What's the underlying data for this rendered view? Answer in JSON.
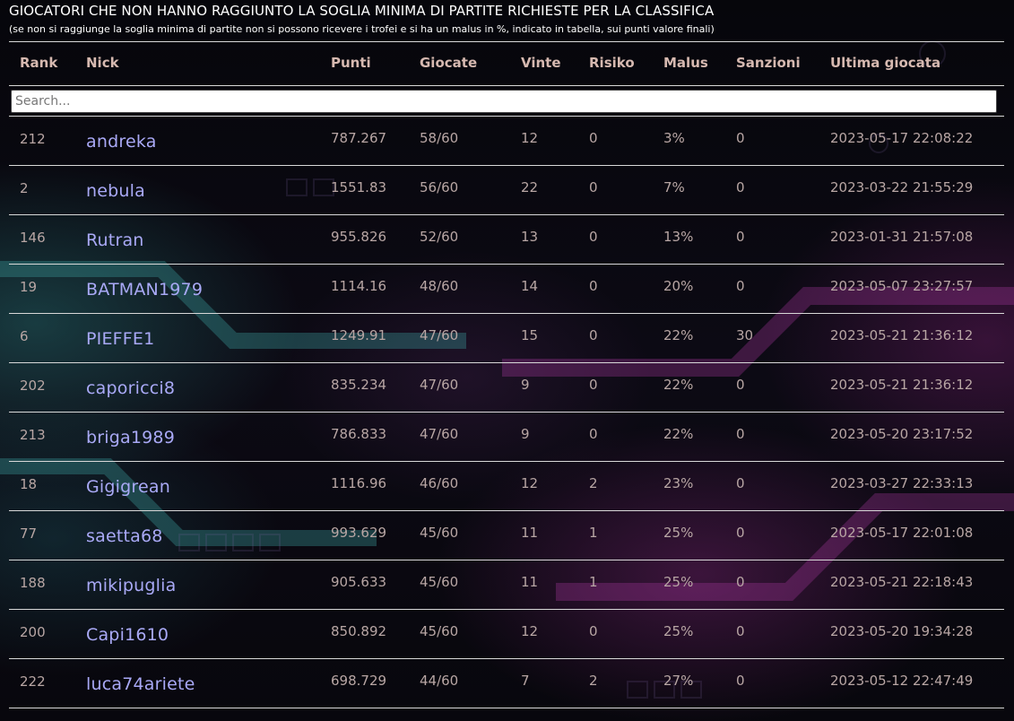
{
  "page": {
    "title": "GIOCATORI CHE NON HANNO RAGGIUNTO LA SOGLIA MINIMA DI PARTITE RICHIESTE PER LA CLASSIFICA",
    "subtitle": "(se non si raggiunge la soglia minima di partite non si possono ricevere i trofei e si ha un malus in %, indicato in tabella, sui punti valore finali)"
  },
  "table": {
    "headers": {
      "rank": "Rank",
      "nick": "Nick",
      "punti": "Punti",
      "giocate": "Giocate",
      "vinte": "Vinte",
      "risiko": "Risiko",
      "malus": "Malus",
      "sanzioni": "Sanzioni",
      "ultima": "Ultima giocata"
    },
    "search": {
      "placeholder": "Search...",
      "value": ""
    },
    "rows": [
      {
        "rank": "212",
        "nick": "andreka",
        "punti": "787.267",
        "giocate": "58/60",
        "vinte": "12",
        "risiko": "0",
        "malus": "3%",
        "sanzioni": "0",
        "ultima": "2023-05-17 22:08:22"
      },
      {
        "rank": "2",
        "nick": "nebula",
        "punti": "1551.83",
        "giocate": "56/60",
        "vinte": "22",
        "risiko": "0",
        "malus": "7%",
        "sanzioni": "0",
        "ultima": "2023-03-22 21:55:29"
      },
      {
        "rank": "146",
        "nick": "Rutran",
        "punti": "955.826",
        "giocate": "52/60",
        "vinte": "13",
        "risiko": "0",
        "malus": "13%",
        "sanzioni": "0",
        "ultima": "2023-01-31 21:57:08"
      },
      {
        "rank": "19",
        "nick": "BATMAN1979",
        "punti": "1114.16",
        "giocate": "48/60",
        "vinte": "14",
        "risiko": "0",
        "malus": "20%",
        "sanzioni": "0",
        "ultima": "2023-05-07 23:27:57"
      },
      {
        "rank": "6",
        "nick": "PIEFFE1",
        "punti": "1249.91",
        "giocate": "47/60",
        "vinte": "15",
        "risiko": "0",
        "malus": "22%",
        "sanzioni": "30",
        "ultima": "2023-05-21 21:36:12"
      },
      {
        "rank": "202",
        "nick": "caporicci8",
        "punti": "835.234",
        "giocate": "47/60",
        "vinte": "9",
        "risiko": "0",
        "malus": "22%",
        "sanzioni": "0",
        "ultima": "2023-05-21 21:36:12"
      },
      {
        "rank": "213",
        "nick": "briga1989",
        "punti": "786.833",
        "giocate": "47/60",
        "vinte": "9",
        "risiko": "0",
        "malus": "22%",
        "sanzioni": "0",
        "ultima": "2023-05-20 23:17:52"
      },
      {
        "rank": "18",
        "nick": "Gigigrean",
        "punti": "1116.96",
        "giocate": "46/60",
        "vinte": "12",
        "risiko": "2",
        "malus": "23%",
        "sanzioni": "0",
        "ultima": "2023-03-27 22:33:13"
      },
      {
        "rank": "77",
        "nick": "saetta68",
        "punti": "993.629",
        "giocate": "45/60",
        "vinte": "11",
        "risiko": "1",
        "malus": "25%",
        "sanzioni": "0",
        "ultima": "2023-05-17 22:01:08"
      },
      {
        "rank": "188",
        "nick": "mikipuglia",
        "punti": "905.633",
        "giocate": "45/60",
        "vinte": "11",
        "risiko": "1",
        "malus": "25%",
        "sanzioni": "0",
        "ultima": "2023-05-21 22:18:43"
      },
      {
        "rank": "200",
        "nick": "Capi1610",
        "punti": "850.892",
        "giocate": "45/60",
        "vinte": "12",
        "risiko": "0",
        "malus": "25%",
        "sanzioni": "0",
        "ultima": "2023-05-20 19:34:28"
      },
      {
        "rank": "222",
        "nick": "luca74ariete",
        "punti": "698.729",
        "giocate": "44/60",
        "vinte": "7",
        "risiko": "2",
        "malus": "27%",
        "sanzioni": "0",
        "ultima": "2023-05-12 22:47:49"
      }
    ]
  },
  "colors": {
    "nick_link": "#a9a9f6",
    "header_text": "#d6b9b0",
    "cell_text": "#b8a6a4",
    "title_text": "#ffffff"
  }
}
